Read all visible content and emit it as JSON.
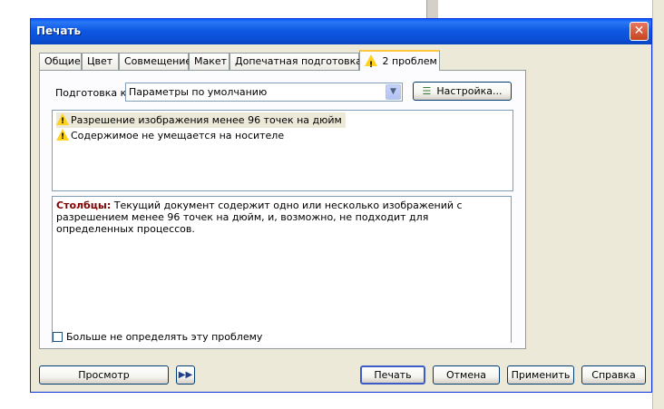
{
  "window": {
    "title": "Печать",
    "close_glyph": "✕"
  },
  "tabs": [
    {
      "label": "Общие"
    },
    {
      "label": "Цвет"
    },
    {
      "label": "Совмещение"
    },
    {
      "label": "Макет"
    },
    {
      "label": "Допечатная подготовка"
    },
    {
      "label": "2 проблем",
      "icon": "warning-icon",
      "active": true
    }
  ],
  "prep": {
    "label": "Подготовка к:",
    "selected": "Параметры по умолчанию",
    "settings_button": "Настройка..."
  },
  "problems": [
    {
      "text": "Разрешение изображения менее 96 точек на дюйм",
      "selected": true
    },
    {
      "text": "Содержимое не умещается на носителе",
      "selected": false
    }
  ],
  "description": {
    "heading": "Столбцы:",
    "text": " Текущий документ содержит одно или несколько изображений с разрешением менее 96 точек на дюйм, и, возможно, не подходит для определенных процессов."
  },
  "checkbox": {
    "label": "Больше не определять эту проблему",
    "checked": false
  },
  "buttons": {
    "preview": "Просмотр",
    "expand_glyph": "▶▶",
    "print": "Печать",
    "cancel": "Отмена",
    "apply": "Применить",
    "help": "Справка"
  },
  "colors": {
    "titlebar": "#0b4fd6",
    "face": "#ece9d8",
    "warning": "#ffd21e",
    "heading": "#800000"
  }
}
